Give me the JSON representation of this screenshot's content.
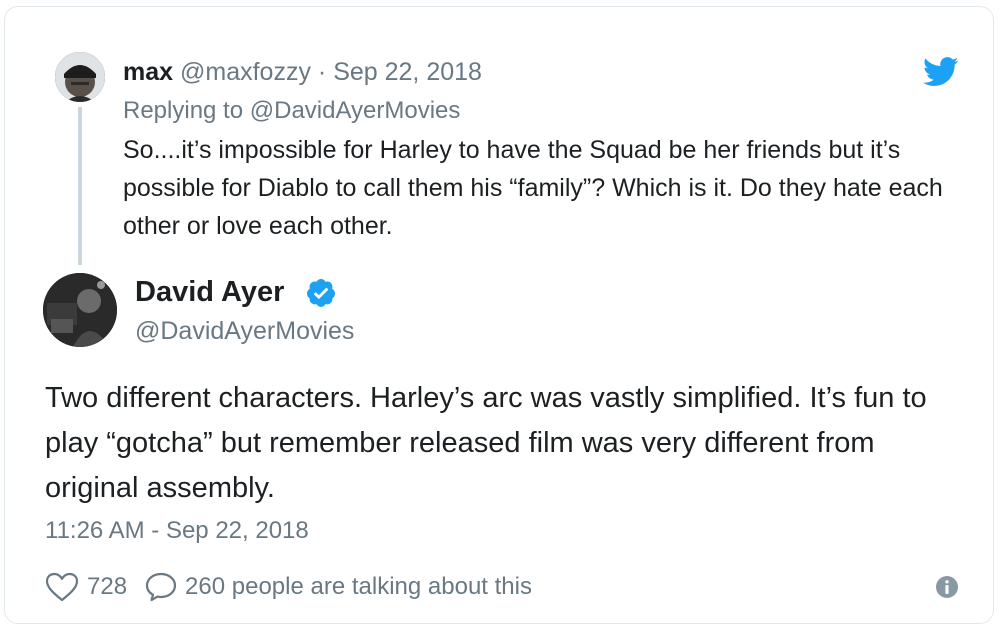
{
  "parent_tweet": {
    "author_name": "max",
    "author_handle": "@maxfozzy",
    "separator": " · ",
    "date": "Sep 22, 2018",
    "replying_label": "Replying to ",
    "replying_handle": "@DavidAyerMovies",
    "text": "So....it’s impossible for Harley to have the Squad be her friends but it’s possible for Diablo to call them his “family”? Which is it. Do they hate each other or love each other."
  },
  "main_tweet": {
    "author_name": "David Ayer",
    "author_handle": "@DavidAyerMovies",
    "verified_icon": "verified-badge-icon",
    "text": "Two different characters. Harley’s arc was vastly simplified. It’s fun to play “gotcha” but remember released film was very different from original assembly.",
    "timestamp": "11:26 AM - Sep 22, 2018"
  },
  "actions": {
    "like_icon": "heart-icon",
    "like_count": "728",
    "reply_icon": "speech-bubble-icon",
    "talking_text": "260 people are talking about this",
    "info_icon": "info-icon"
  },
  "brand": {
    "logo_icon": "twitter-bird-icon",
    "accent_color": "#1da1f2",
    "muted_color": "#697882",
    "text_color": "#1c2022"
  }
}
